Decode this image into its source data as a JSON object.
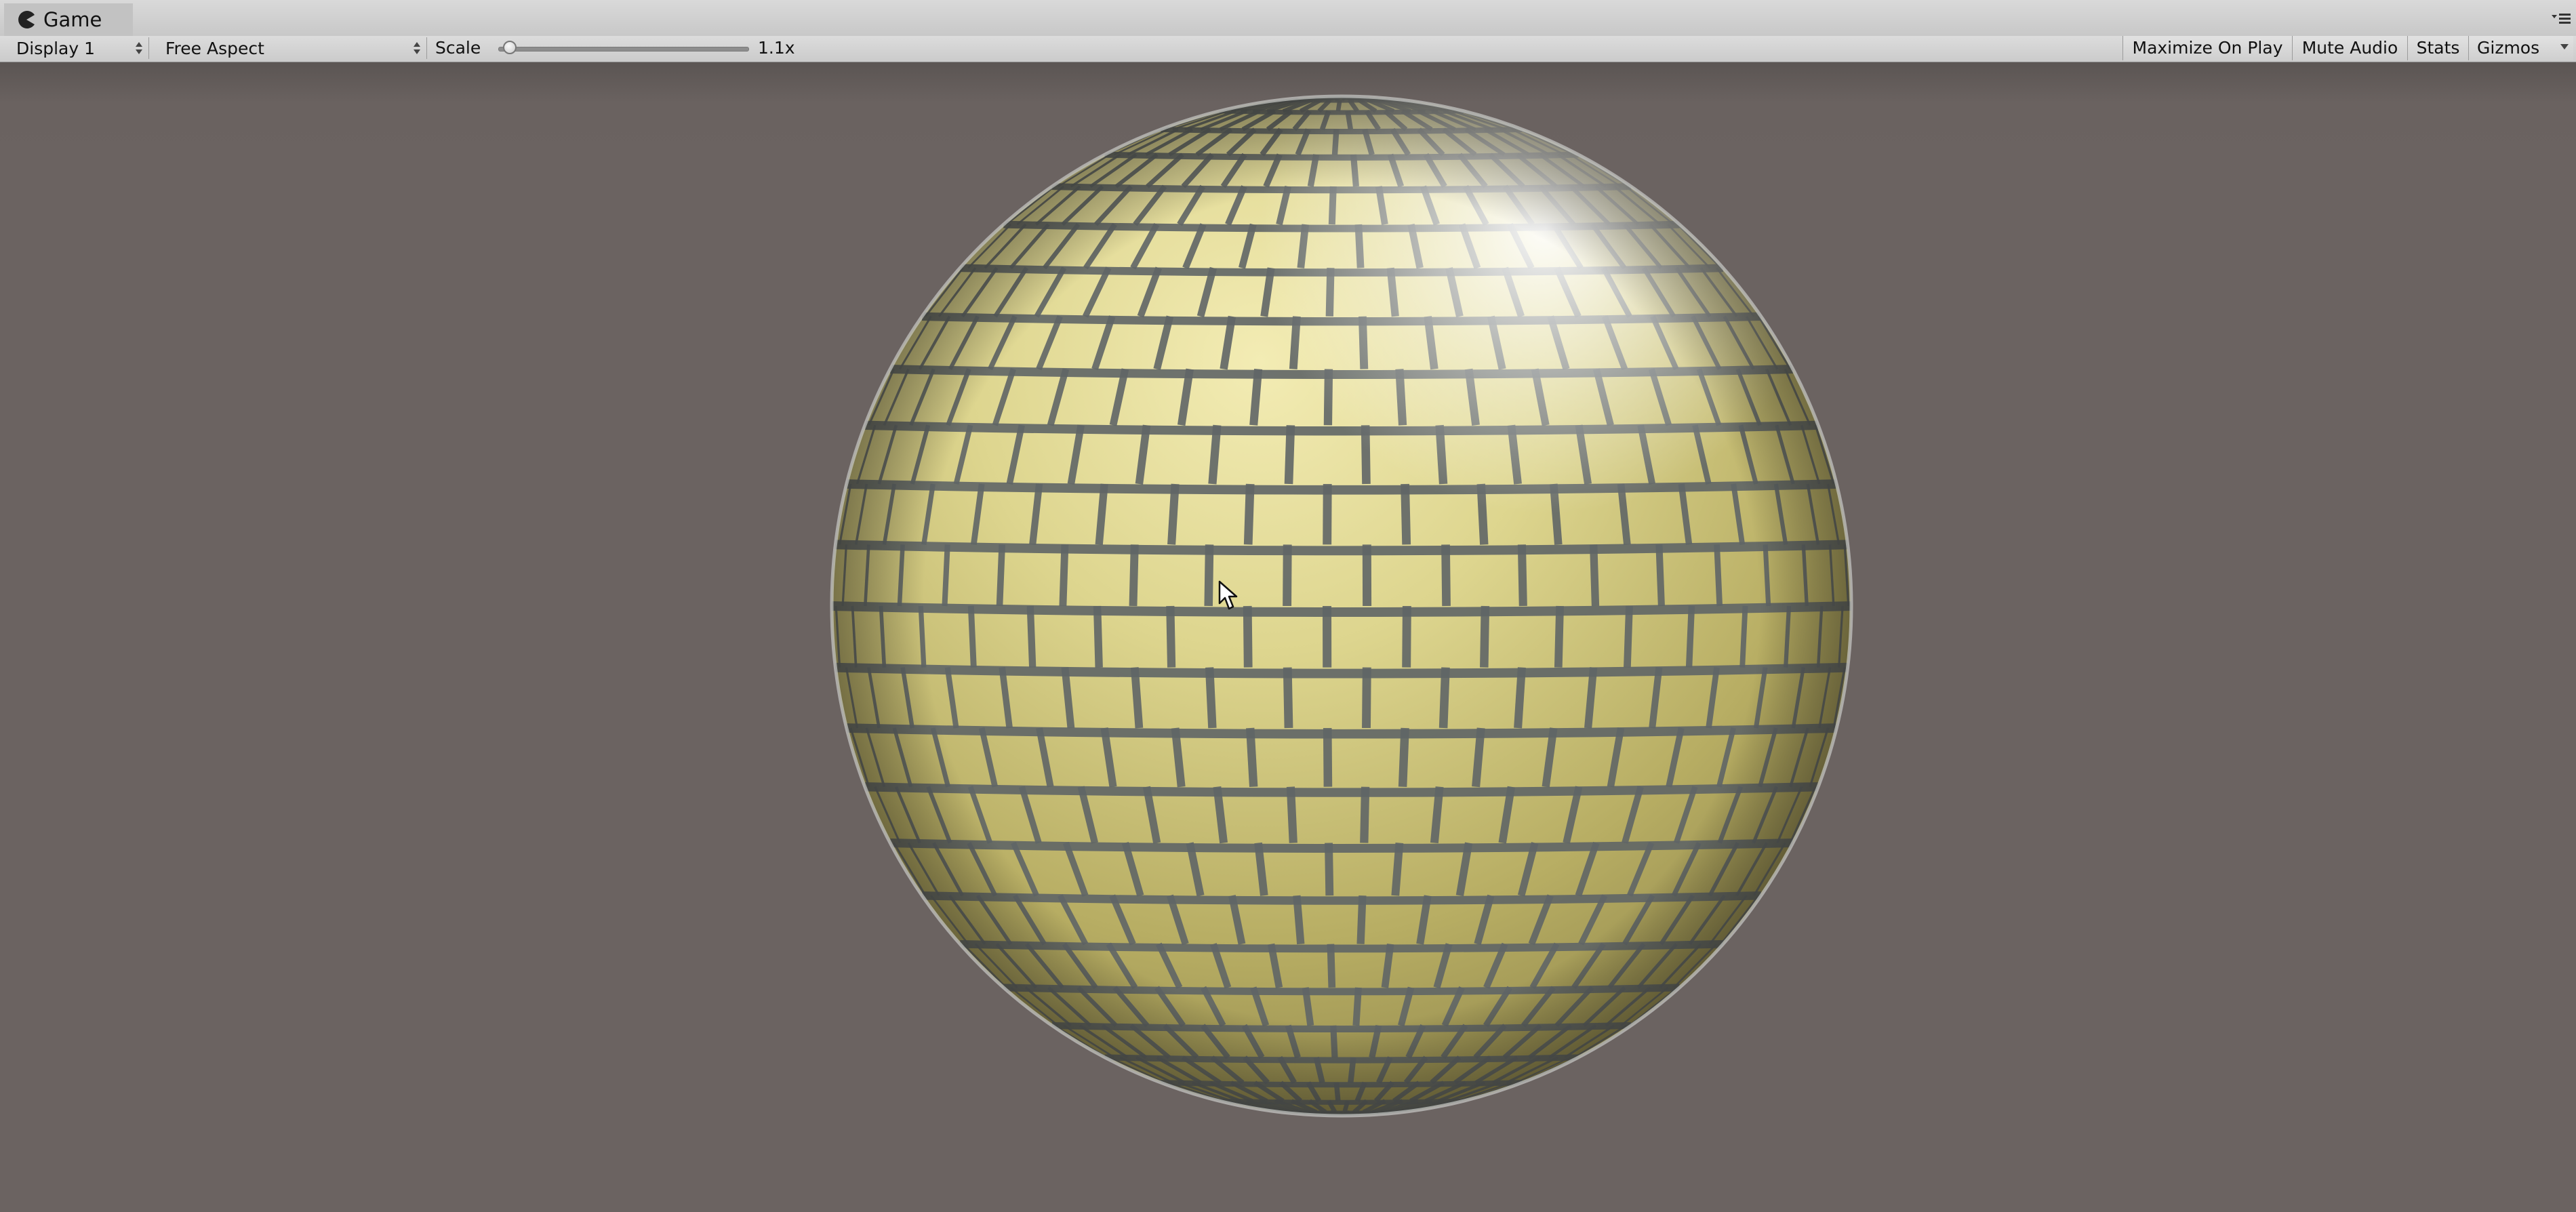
{
  "window": {
    "tab_title": "Game",
    "tab_icon": "pacman-icon",
    "tab_menu_icon": "panel-menu-icon"
  },
  "toolbar": {
    "display_select": "Display 1",
    "aspect_select": "Free Aspect",
    "scale_label": "Scale",
    "scale_value": "1.1x",
    "scale_slider_fraction": 0.02,
    "buttons": {
      "maximize_on_play": "Maximize On Play",
      "mute_audio": "Mute Audio",
      "stats": "Stats",
      "gizmos": "Gizmos"
    }
  },
  "scene": {
    "object": "brick-textured-sphere",
    "background_color": "#6b6361",
    "brick_color": "#d8cf86",
    "mortar_color": "#5f6566"
  }
}
